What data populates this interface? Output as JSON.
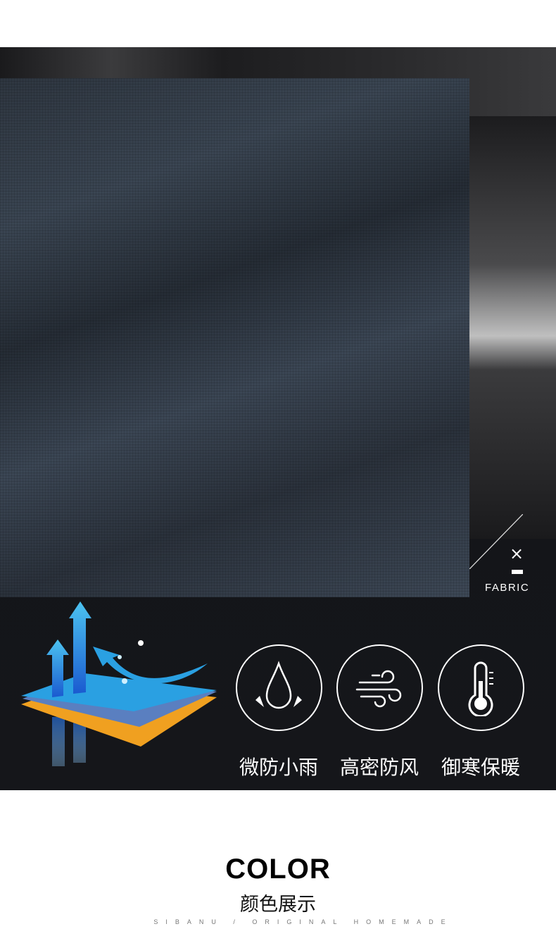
{
  "fabric_section": {
    "label": "FABRIC",
    "mark": "×"
  },
  "features": [
    {
      "icon": "water-drop-icon",
      "label": "微防小雨"
    },
    {
      "icon": "wind-icon",
      "label": "高密防风"
    },
    {
      "icon": "thermometer-icon",
      "label": "御寒保暖"
    }
  ],
  "color_section": {
    "title": "COLOR",
    "subtitle": "颜色展示",
    "tagline": "SIBANU / ORIGINAL HOMEMADE"
  },
  "colors": {
    "accent_blue": "#2a9be0",
    "accent_orange": "#f0a020",
    "dark_bg": "#15161a"
  }
}
